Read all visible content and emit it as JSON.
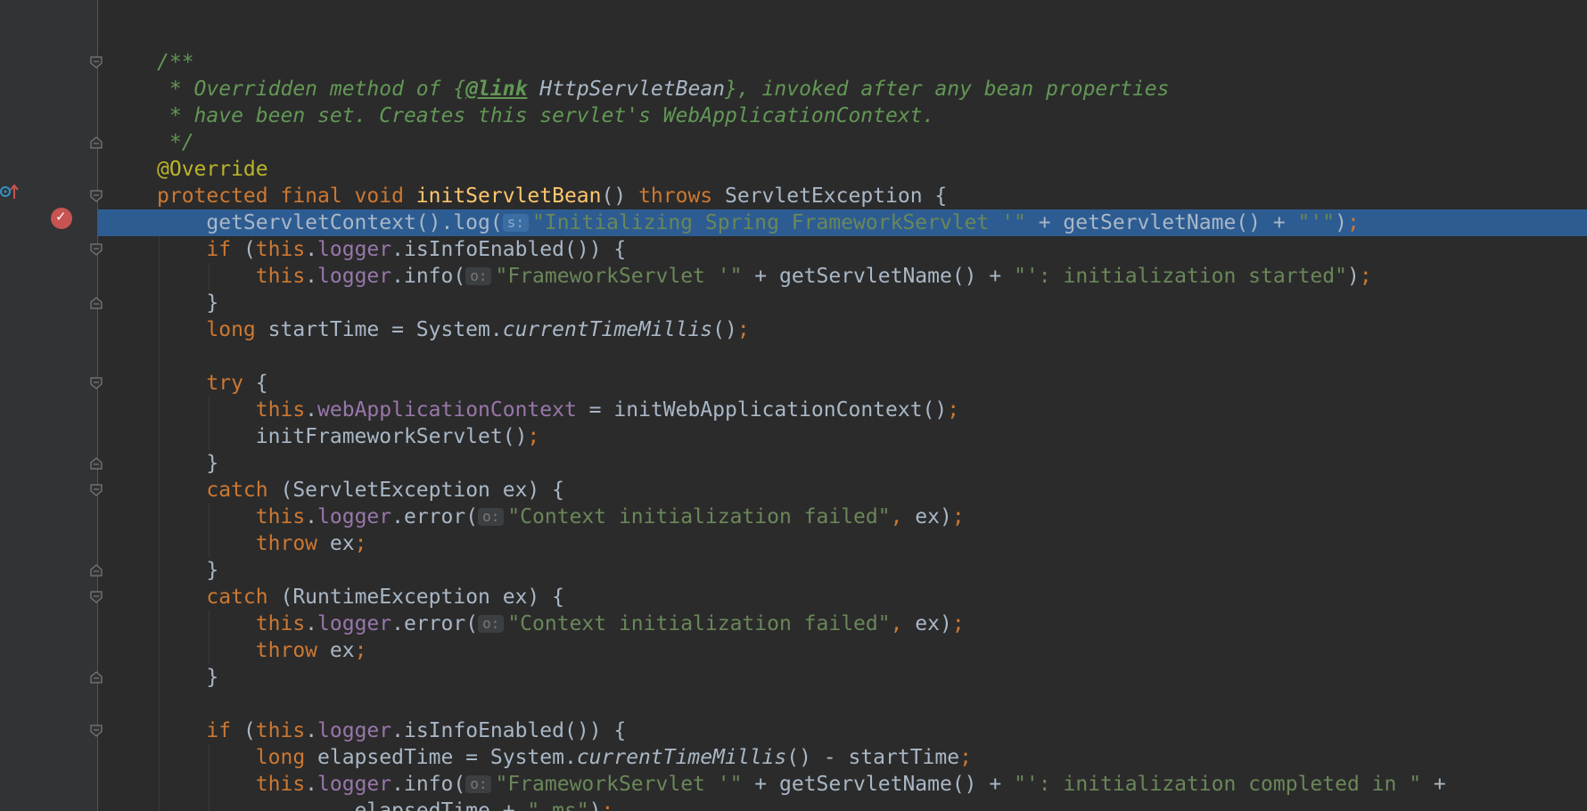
{
  "editor": {
    "lines": [
      {
        "parts": [
          {
            "c": "doc",
            "t": "/**"
          }
        ]
      },
      {
        "parts": [
          {
            "c": "doc",
            "t": " * Overridden method of {"
          },
          {
            "c": "doc-tag",
            "t": "@link"
          },
          {
            "c": "doc-ref",
            "t": " HttpServletBean"
          },
          {
            "c": "doc",
            "t": "}, invoked after any bean properties"
          }
        ]
      },
      {
        "parts": [
          {
            "c": "doc",
            "t": " * have been set. Creates this servlet's WebApplicationContext."
          }
        ]
      },
      {
        "parts": [
          {
            "c": "doc",
            "t": " */"
          }
        ]
      },
      {
        "parts": [
          {
            "c": "ann",
            "t": "@Override"
          }
        ]
      },
      {
        "parts": [
          {
            "c": "kw",
            "t": "protected final void "
          },
          {
            "c": "fn",
            "t": "initServletBean"
          },
          {
            "c": "",
            "t": "() "
          },
          {
            "c": "kw",
            "t": "throws "
          },
          {
            "c": "",
            "t": "ServletException {"
          }
        ]
      },
      {
        "highlighted": true,
        "parts": [
          {
            "c": "",
            "t": "    getServletContext().log("
          },
          {
            "c": "hint",
            "t": "s:"
          },
          {
            "c": "str",
            "t": "\"Initializing Spring FrameworkServlet '\""
          },
          {
            "c": "",
            "t": " + getServletName() + "
          },
          {
            "c": "str",
            "t": "\"'\""
          },
          {
            "c": "",
            "t": ")"
          },
          {
            "c": "semi",
            "t": ";"
          }
        ]
      },
      {
        "parts": [
          {
            "c": "kw",
            "t": "    if "
          },
          {
            "c": "",
            "t": "("
          },
          {
            "c": "kw",
            "t": "this"
          },
          {
            "c": "",
            "t": "."
          },
          {
            "c": "field",
            "t": "logger"
          },
          {
            "c": "",
            "t": ".isInfoEnabled()) {"
          }
        ]
      },
      {
        "parts": [
          {
            "c": "kw",
            "t": "        this"
          },
          {
            "c": "",
            "t": "."
          },
          {
            "c": "field",
            "t": "logger"
          },
          {
            "c": "",
            "t": ".info("
          },
          {
            "c": "hint",
            "t": "o:"
          },
          {
            "c": "str",
            "t": "\"FrameworkServlet '\""
          },
          {
            "c": "",
            "t": " + getServletName() + "
          },
          {
            "c": "str",
            "t": "\"': initialization started\""
          },
          {
            "c": "",
            "t": ")"
          },
          {
            "c": "semi",
            "t": ";"
          }
        ]
      },
      {
        "parts": [
          {
            "c": "",
            "t": "    }"
          }
        ]
      },
      {
        "parts": [
          {
            "c": "kw",
            "t": "    long "
          },
          {
            "c": "",
            "t": "startTime = System."
          },
          {
            "c": "static",
            "t": "currentTimeMillis"
          },
          {
            "c": "",
            "t": "()"
          },
          {
            "c": "semi",
            "t": ";"
          }
        ]
      },
      {
        "parts": [
          {
            "c": "",
            "t": ""
          }
        ]
      },
      {
        "parts": [
          {
            "c": "kw",
            "t": "    try "
          },
          {
            "c": "",
            "t": "{"
          }
        ]
      },
      {
        "parts": [
          {
            "c": "kw",
            "t": "        this"
          },
          {
            "c": "",
            "t": "."
          },
          {
            "c": "field",
            "t": "webApplicationContext"
          },
          {
            "c": "",
            "t": " = initWebApplicationContext()"
          },
          {
            "c": "semi",
            "t": ";"
          }
        ]
      },
      {
        "parts": [
          {
            "c": "",
            "t": "        initFrameworkServlet()"
          },
          {
            "c": "semi",
            "t": ";"
          }
        ]
      },
      {
        "parts": [
          {
            "c": "",
            "t": "    }"
          }
        ]
      },
      {
        "parts": [
          {
            "c": "kw",
            "t": "    catch "
          },
          {
            "c": "",
            "t": "(ServletException ex) {"
          }
        ]
      },
      {
        "parts": [
          {
            "c": "kw",
            "t": "        this"
          },
          {
            "c": "",
            "t": "."
          },
          {
            "c": "field",
            "t": "logger"
          },
          {
            "c": "",
            "t": ".error("
          },
          {
            "c": "hint",
            "t": "o:"
          },
          {
            "c": "str",
            "t": "\"Context initialization failed\""
          },
          {
            "c": "semi",
            "t": ","
          },
          {
            "c": "",
            "t": " ex)"
          },
          {
            "c": "semi",
            "t": ";"
          }
        ]
      },
      {
        "parts": [
          {
            "c": "kw",
            "t": "        throw "
          },
          {
            "c": "",
            "t": "ex"
          },
          {
            "c": "semi",
            "t": ";"
          }
        ]
      },
      {
        "parts": [
          {
            "c": "",
            "t": "    }"
          }
        ]
      },
      {
        "parts": [
          {
            "c": "kw",
            "t": "    catch "
          },
          {
            "c": "",
            "t": "(RuntimeException ex) {"
          }
        ]
      },
      {
        "parts": [
          {
            "c": "kw",
            "t": "        this"
          },
          {
            "c": "",
            "t": "."
          },
          {
            "c": "field",
            "t": "logger"
          },
          {
            "c": "",
            "t": ".error("
          },
          {
            "c": "hint",
            "t": "o:"
          },
          {
            "c": "str",
            "t": "\"Context initialization failed\""
          },
          {
            "c": "semi",
            "t": ","
          },
          {
            "c": "",
            "t": " ex)"
          },
          {
            "c": "semi",
            "t": ";"
          }
        ]
      },
      {
        "parts": [
          {
            "c": "kw",
            "t": "        throw "
          },
          {
            "c": "",
            "t": "ex"
          },
          {
            "c": "semi",
            "t": ";"
          }
        ]
      },
      {
        "parts": [
          {
            "c": "",
            "t": "    }"
          }
        ]
      },
      {
        "parts": [
          {
            "c": "",
            "t": ""
          }
        ]
      },
      {
        "parts": [
          {
            "c": "kw",
            "t": "    if "
          },
          {
            "c": "",
            "t": "("
          },
          {
            "c": "kw",
            "t": "this"
          },
          {
            "c": "",
            "t": "."
          },
          {
            "c": "field",
            "t": "logger"
          },
          {
            "c": "",
            "t": ".isInfoEnabled()) {"
          }
        ]
      },
      {
        "parts": [
          {
            "c": "kw",
            "t": "        long "
          },
          {
            "c": "",
            "t": "elapsedTime = System."
          },
          {
            "c": "static",
            "t": "currentTimeMillis"
          },
          {
            "c": "",
            "t": "() - startTime"
          },
          {
            "c": "semi",
            "t": ";"
          }
        ]
      },
      {
        "parts": [
          {
            "c": "kw",
            "t": "        this"
          },
          {
            "c": "",
            "t": "."
          },
          {
            "c": "field",
            "t": "logger"
          },
          {
            "c": "",
            "t": ".info("
          },
          {
            "c": "hint",
            "t": "o:"
          },
          {
            "c": "str",
            "t": "\"FrameworkServlet '\""
          },
          {
            "c": "",
            "t": " + getServletName() + "
          },
          {
            "c": "str",
            "t": "\"': initialization completed in \""
          },
          {
            "c": "",
            "t": " +"
          }
        ]
      },
      {
        "parts": [
          {
            "c": "",
            "t": "                elapsedTime + "
          },
          {
            "c": "str",
            "t": "\" ms\""
          },
          {
            "c": "",
            "t": ")"
          },
          {
            "c": "semi",
            "t": ";"
          }
        ]
      }
    ],
    "fold_markers": [
      {
        "line": 0,
        "kind": "open"
      },
      {
        "line": 3,
        "kind": "close"
      },
      {
        "line": 5,
        "kind": "open"
      },
      {
        "line": 7,
        "kind": "open"
      },
      {
        "line": 9,
        "kind": "close"
      },
      {
        "line": 12,
        "kind": "open"
      },
      {
        "line": 15,
        "kind": "close"
      },
      {
        "line": 16,
        "kind": "open"
      },
      {
        "line": 19,
        "kind": "close"
      },
      {
        "line": 20,
        "kind": "open"
      },
      {
        "line": 23,
        "kind": "close"
      },
      {
        "line": 25,
        "kind": "open"
      }
    ],
    "breakpoint_line": 6,
    "override_line": 5,
    "colors": {
      "background": "#2b2b2b",
      "highlight": "#2d5c92",
      "breakpoint": "#c75450",
      "override_icon": "#3592c4"
    },
    "icons": {
      "breakpoint": "breakpoint-verified-icon",
      "override": "overrides-method-icon",
      "fold": "fold-marker-icon"
    }
  }
}
